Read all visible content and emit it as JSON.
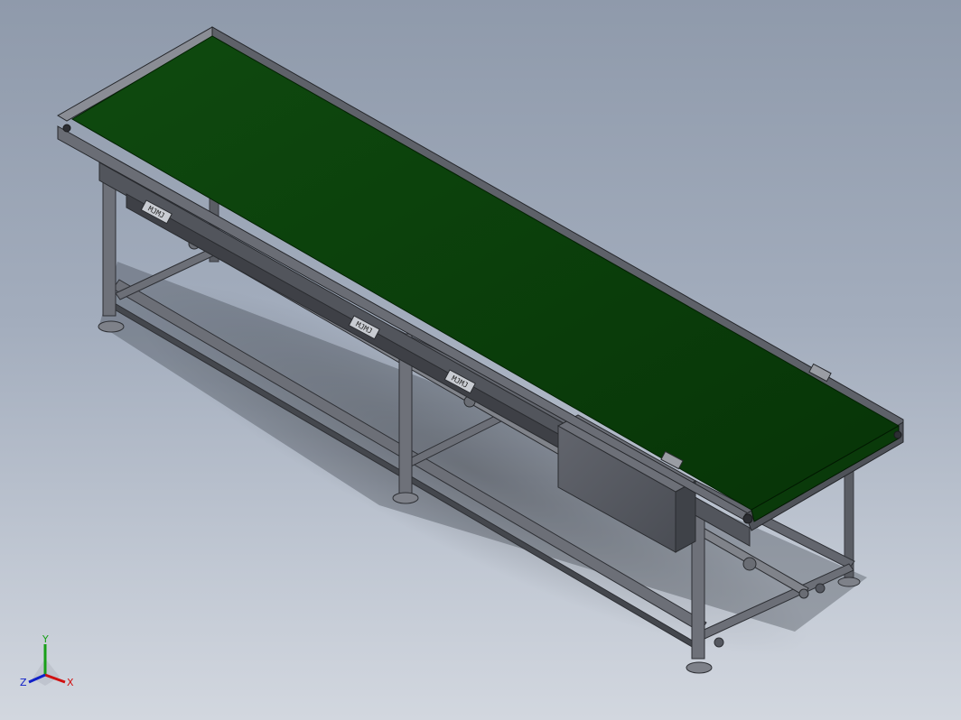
{
  "viewport": {
    "background_top": "#8f9aab",
    "background_bottom": "#d2d7df"
  },
  "model": {
    "belt_color": "#0b3d0b",
    "frame_color": "#5d6068",
    "box_color": "#55585f",
    "motor_labels": [
      "MJMJ",
      "MJMJ",
      "MJMJ"
    ]
  },
  "triad": {
    "x_label": "X",
    "y_label": "Y",
    "z_label": "Z",
    "x_color": "#d01010",
    "y_color": "#18a018",
    "z_color": "#1020c8"
  }
}
